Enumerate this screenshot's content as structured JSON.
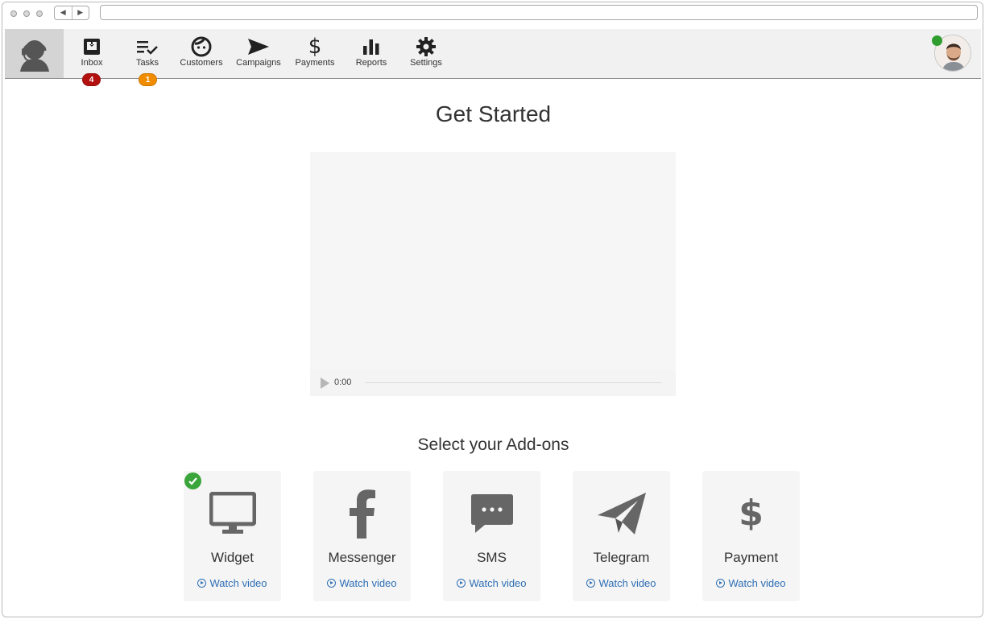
{
  "nav": {
    "items": [
      {
        "label": "Inbox",
        "icon": "inbox-icon"
      },
      {
        "label": "Tasks",
        "icon": "tasks-icon"
      },
      {
        "label": "Customers",
        "icon": "customers-icon"
      },
      {
        "label": "Campaigns",
        "icon": "campaigns-icon"
      },
      {
        "label": "Payments",
        "icon": "payments-icon"
      },
      {
        "label": "Reports",
        "icon": "reports-icon"
      },
      {
        "label": "Settings",
        "icon": "settings-icon"
      }
    ],
    "inbox_badge": "4",
    "tasks_badge": "1"
  },
  "colors": {
    "inbox_badge": "#b3110f",
    "tasks_badge": "#f08c00",
    "online": "#2f9e2f",
    "link": "#2e6fb5",
    "icon": "#666666"
  },
  "main": {
    "title": "Get Started",
    "video_time": "0:00",
    "addons_title": "Select your Add-ons"
  },
  "addons": [
    {
      "name": "Widget",
      "link": "Watch video",
      "icon": "monitor-icon",
      "selected": true
    },
    {
      "name": "Messenger",
      "link": "Watch video",
      "icon": "facebook-icon",
      "selected": false
    },
    {
      "name": "SMS",
      "link": "Watch video",
      "icon": "chat-bubble-icon",
      "selected": false
    },
    {
      "name": "Telegram",
      "link": "Watch video",
      "icon": "paper-plane-icon",
      "selected": false
    },
    {
      "name": "Payment",
      "link": "Watch video",
      "icon": "dollar-icon",
      "selected": false
    }
  ]
}
